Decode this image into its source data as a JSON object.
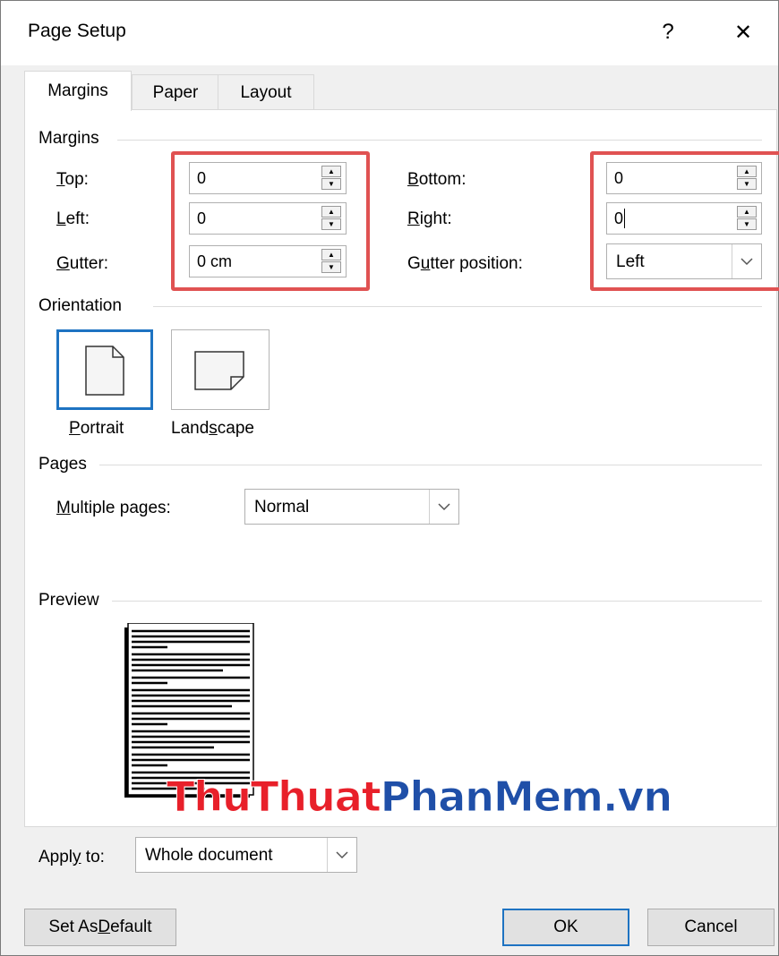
{
  "dialog": {
    "title": "Page Setup",
    "help_label": "?",
    "close_label": "✕"
  },
  "tabs": [
    {
      "label": "Margins",
      "active": true
    },
    {
      "label": "Paper",
      "active": false
    },
    {
      "label": "Layout",
      "active": false
    }
  ],
  "margins": {
    "section_label": "Margins",
    "top": {
      "label_pre": "",
      "label_key": "T",
      "label_post": "op:",
      "value": "0"
    },
    "left": {
      "label_pre": "",
      "label_key": "L",
      "label_post": "eft:",
      "value": "0"
    },
    "gutter": {
      "label_pre": "",
      "label_key": "G",
      "label_post": "utter:",
      "value": "0 cm"
    },
    "bottom": {
      "label_pre": "",
      "label_key": "B",
      "label_post": "ottom:",
      "value": "0"
    },
    "right": {
      "label_pre": "",
      "label_key": "R",
      "label_post": "ight:",
      "value": "0"
    },
    "gutter_position": {
      "label_pre": "G",
      "label_key": "u",
      "label_post": "tter position:",
      "value": "Left"
    }
  },
  "orientation": {
    "section_label": "Orientation",
    "portrait": {
      "label_pre": "",
      "label_key": "P",
      "label_post": "ortrait",
      "selected": true
    },
    "landscape": {
      "label_pre": "Land",
      "label_key": "s",
      "label_post": "cape",
      "selected": false
    }
  },
  "pages": {
    "section_label": "Pages",
    "multiple_pages": {
      "label_pre": "",
      "label_key": "M",
      "label_post": "ultiple pages:",
      "value": "Normal"
    }
  },
  "preview": {
    "section_label": "Preview"
  },
  "apply_to": {
    "label_pre": "Appl",
    "label_key": "y",
    "label_post": " to:",
    "value": "Whole document"
  },
  "buttons": {
    "set_default_pre": "Set As ",
    "set_default_key": "D",
    "set_default_post": "efault",
    "ok": "OK",
    "cancel": "Cancel"
  },
  "watermark": {
    "part1": "ThuThuat",
    "part2": "PhanMem",
    "part3": ".vn",
    "color1": "#e8202a",
    "color2": "#1f4fa8"
  },
  "colors": {
    "highlight_box": "#e05252",
    "selection_blue": "#1e73c2"
  }
}
